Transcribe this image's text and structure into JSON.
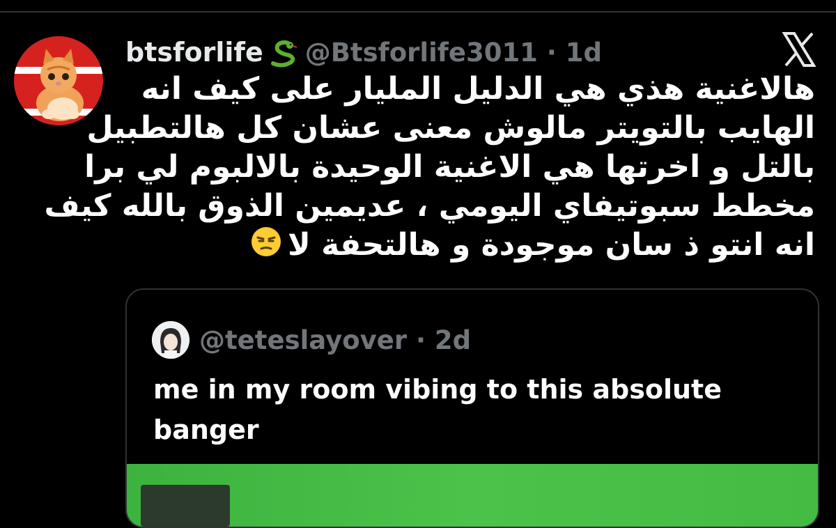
{
  "tweet": {
    "display_name": "btsforlife",
    "name_emoji_icon": "snake-icon",
    "handle_line": "@Btsforlife3011 · 1d",
    "text_lines": [
      "هالاغنية هذي هي الدليل المليار على كيف انه",
      "الهايب بالتويتر مالوش معنى عشان كل هالتطبيل",
      "بالتل و اخرتها هي الاغنية الوحيدة بالالبوم لي برا",
      "مخطط سبوتيفاي اليومي ، عديمين الذوق بالله كيف",
      "انه انتو ذ سان موجودة و هالتحفة لا"
    ],
    "end_emoji_icon": "unamused-face-icon"
  },
  "quote": {
    "handle_line": "@teteslayover · 2d",
    "text": "me in my room vibing to this absolute banger"
  },
  "colors": {
    "background": "#000000",
    "primary_text": "#e7e9ea",
    "secondary_text": "#71767b",
    "border": "#2f3336",
    "avatar_red": "#d6221f",
    "media_green": "#44bb42"
  }
}
